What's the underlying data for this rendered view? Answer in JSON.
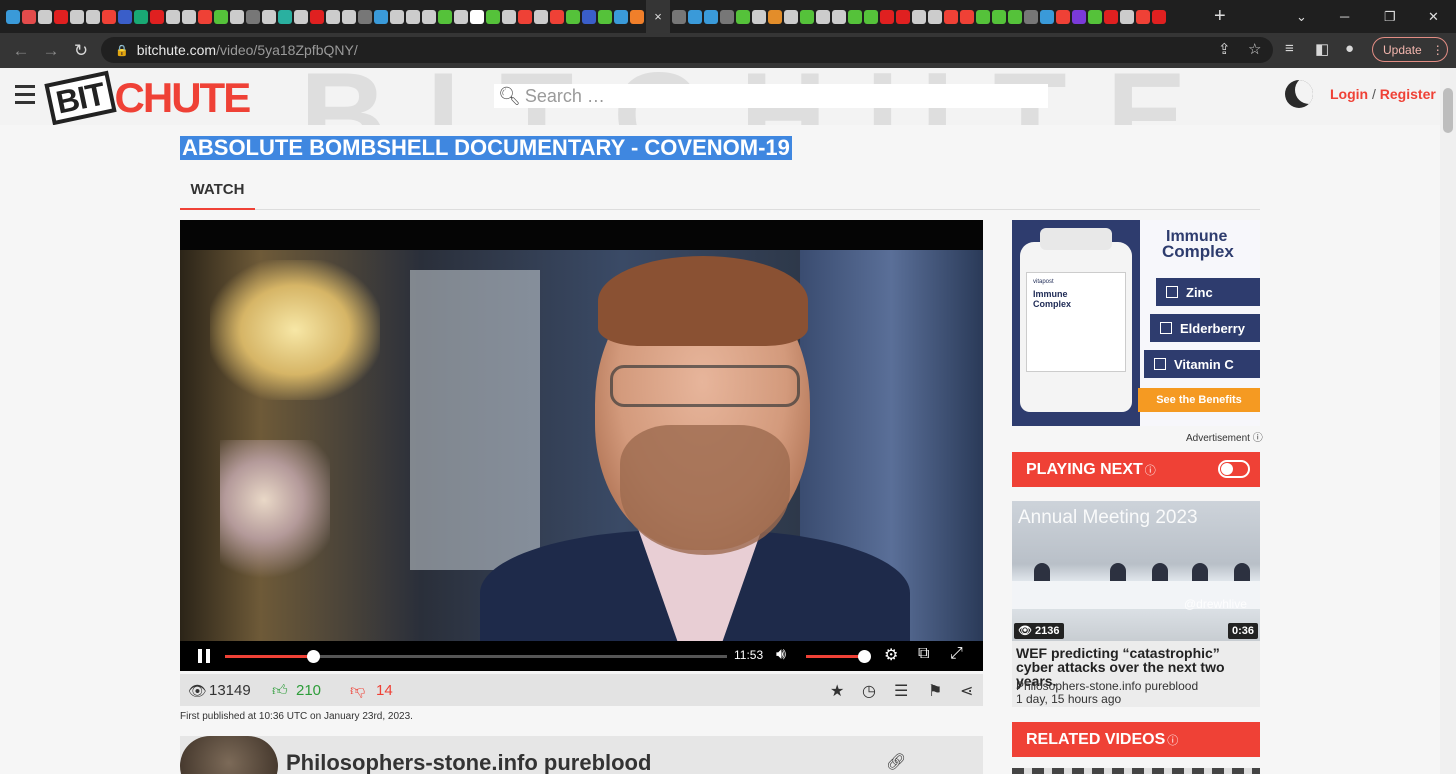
{
  "browser": {
    "tab_icon_colors": [
      "#3a9ad9",
      "#e34b4b",
      "#cccccc",
      "#e02020",
      "#cccccc",
      "#cccccc",
      "#ef4136",
      "#3a5ec9",
      "#19a974",
      "#e02020",
      "#cccccc",
      "#cccccc",
      "#ef4136",
      "#55c23a",
      "#cccccc",
      "#777777",
      "#cccccc",
      "#2ab0a0",
      "#cccccc",
      "#e02020",
      "#cccccc",
      "#cccccc",
      "#777777",
      "#3a9ad9",
      "#cccccc",
      "#cccccc",
      "#cccccc",
      "#55c23a",
      "#cccccc",
      "#ffffff",
      "#55c23a",
      "#cccccc",
      "#ef4136",
      "#cccccc",
      "#ef4136",
      "#55c23a",
      "#3a5ec9",
      "#55c23a",
      "#3a9ad9",
      "#f07f2a"
    ],
    "tab_icon_colors_right": [
      "#777777",
      "#3a9ad9",
      "#3a9ad9",
      "#777777",
      "#55c23a",
      "#cccccc",
      "#e38d2a",
      "#cccccc",
      "#55c23a",
      "#cccccc",
      "#cccccc",
      "#55c23a",
      "#55c23a",
      "#e02020",
      "#e02020",
      "#cccccc",
      "#cccccc",
      "#ef4136",
      "#ef4136",
      "#55c23a",
      "#55c23a",
      "#55c23a",
      "#777777",
      "#3a9ad9",
      "#ef4136",
      "#7a3ad9",
      "#55c23a",
      "#e02020",
      "#cccccc",
      "#ef4136",
      "#e02020"
    ],
    "active_tab_close": "×",
    "new_tab": "+",
    "url_host": "bitchute.com",
    "url_path": "/video/5ya18ZpfbQNY/",
    "update_label": "Update"
  },
  "header": {
    "logo_bit": "BIT",
    "logo_chute": "CHUTE",
    "watermark": "BITCHUTE",
    "search_placeholder": "Search …",
    "login": "Login",
    "register": "Register"
  },
  "video": {
    "title": "ABSOLUTE BOMBSHELL DOCUMENTARY - COVENOM-19",
    "tab_label": "WATCH",
    "time_remaining": "11:53",
    "progress_fraction": 0.175,
    "volume_fraction": 1.0,
    "views": "13149",
    "likes": "210",
    "dislikes": "14",
    "published": "First published at 10:36 UTC on January 23rd, 2023.",
    "channel_name": "Philosophers-stone.info pureblood"
  },
  "ad": {
    "heading_top": "Immune",
    "heading_bottom": "Complex",
    "bottle_brand": "vitapost",
    "bottle_title": "Immune Complex",
    "items": [
      "Zinc",
      "Elderberry",
      "Vitamin C"
    ],
    "cta": "See the Benefits",
    "label": "Advertisement"
  },
  "sidebar": {
    "playing_next": "PLAYING NEXT",
    "next_video": {
      "thumb_banner": "Annual Meeting 2023",
      "thumb_handle": "@drewhlive",
      "views": "2136",
      "duration": "0:36",
      "title": "WEF predicting “catastrophic” cyber attacks over the next two years.",
      "channel": "Philosophers-stone.info pureblood",
      "age": "1 day, 15 hours ago"
    },
    "related": "RELATED VIDEOS"
  },
  "colors": {
    "brand_red": "#ef4136",
    "selection_blue": "#3f87e0",
    "like_green": "#2e9d3a"
  }
}
